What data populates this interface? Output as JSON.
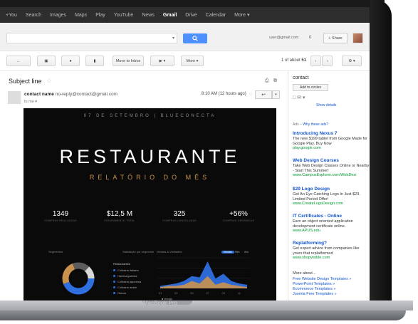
{
  "gbar": {
    "items": [
      "+You",
      "Search",
      "Images",
      "Maps",
      "Play",
      "YouTube",
      "News",
      "Gmail",
      "Drive",
      "Calendar",
      "More ▾"
    ]
  },
  "header": {
    "search_placeholder": "",
    "email": "user@gmail.com",
    "notifications": "0",
    "share_label": "+ Share"
  },
  "toolbar": {
    "move_label": "Move to Inbox",
    "more_label": "More ▾",
    "count_prefix": "1 of about ",
    "count_total": "51"
  },
  "message": {
    "subject": "Subject line",
    "sender_name": "contact name",
    "sender_email": "no-reply@contact@gmail.com",
    "to": "to me",
    "date": "8:10 AM (12 hours ago)"
  },
  "side": {
    "contact": "contact",
    "add_circles": "Add to circles",
    "show_details": "Show details",
    "ads_label": "Ads – ",
    "ads_why": "Why these ads?",
    "ads": [
      {
        "title": "Introducing Nexus 7",
        "desc": "The new $199 tablet from Google Made for Google Play. Buy Now",
        "url": "play.google.com"
      },
      {
        "title": "Web Design Courses",
        "desc": "Take Web Design Classes Online or Nearby - Start This Summer!",
        "url": "www.CampusExplorer.com/WebDesi"
      },
      {
        "title": "$29 Logo Design",
        "desc": "Get An Eye Catching Logo In Just $29. Limited Period Offer!",
        "url": "www.CreateLogoDesign.com"
      },
      {
        "title": "IT Certificates - Online",
        "desc": "Earn an object oriented application development certificate online.",
        "url": "www.APUS.edu"
      },
      {
        "title": "Replatforming?",
        "desc": "Get expert advice from companies like yours that replatformed",
        "url": "www.shopvisible.com"
      }
    ],
    "more_about": "More about...",
    "more_links": [
      "Free Website Design Templates »",
      "PowerPoint Templates »",
      "Ecommerce Templates »",
      "Joomla Free Templates »"
    ]
  },
  "newsletter": {
    "date_line": "07 DE SETEMBRO | BLUECONECTA",
    "title": "RESTAURANTE",
    "subtitle": "RELATÓRIO DO MÊS",
    "stats": [
      {
        "value": "1349",
        "label": "COMPRAS REALIZADAS"
      },
      {
        "value": "$12,5 M",
        "label": "FATURAMENTO TOTAL"
      },
      {
        "value": "325",
        "label": "COMPRAS CANCELADAS"
      },
      {
        "value": "+56%",
        "label": "COMPRAS ORGANICAS"
      }
    ],
    "panel1_title": "Segmentos",
    "panel1_right": "Satisfação por segmento",
    "legend_title": "Restaurantes",
    "legend": [
      "Culinária italiana",
      "Hamburguerias",
      "Culinária japonesa",
      "Culinária árabe",
      "Outros"
    ],
    "panel2_title": "Vendas & Visitantes",
    "pills": [
      "Vendas",
      "Mês",
      "Ano"
    ],
    "chart_legend": "Vendas",
    "accent": "#2f6fe0",
    "accent2": "#c9924c"
  },
  "laptop_label": "MacBook Pro",
  "chart_data": {
    "type": "area",
    "title": "Vendas & Visitantes",
    "x": [
      "01",
      "02",
      "03",
      "04",
      "05",
      "06",
      "07",
      "08",
      "09",
      "10",
      "11",
      "12"
    ],
    "series": [
      {
        "name": "Vendas",
        "values": [
          2,
          3,
          4,
          6,
          10,
          9,
          22,
          8,
          12,
          6,
          4,
          3
        ]
      },
      {
        "values": [
          1,
          2,
          2,
          3,
          6,
          4,
          10,
          3,
          5,
          3,
          2,
          1
        ]
      }
    ],
    "xlabel": "",
    "ylabel": "",
    "ylim": [
      0,
      25
    ]
  }
}
